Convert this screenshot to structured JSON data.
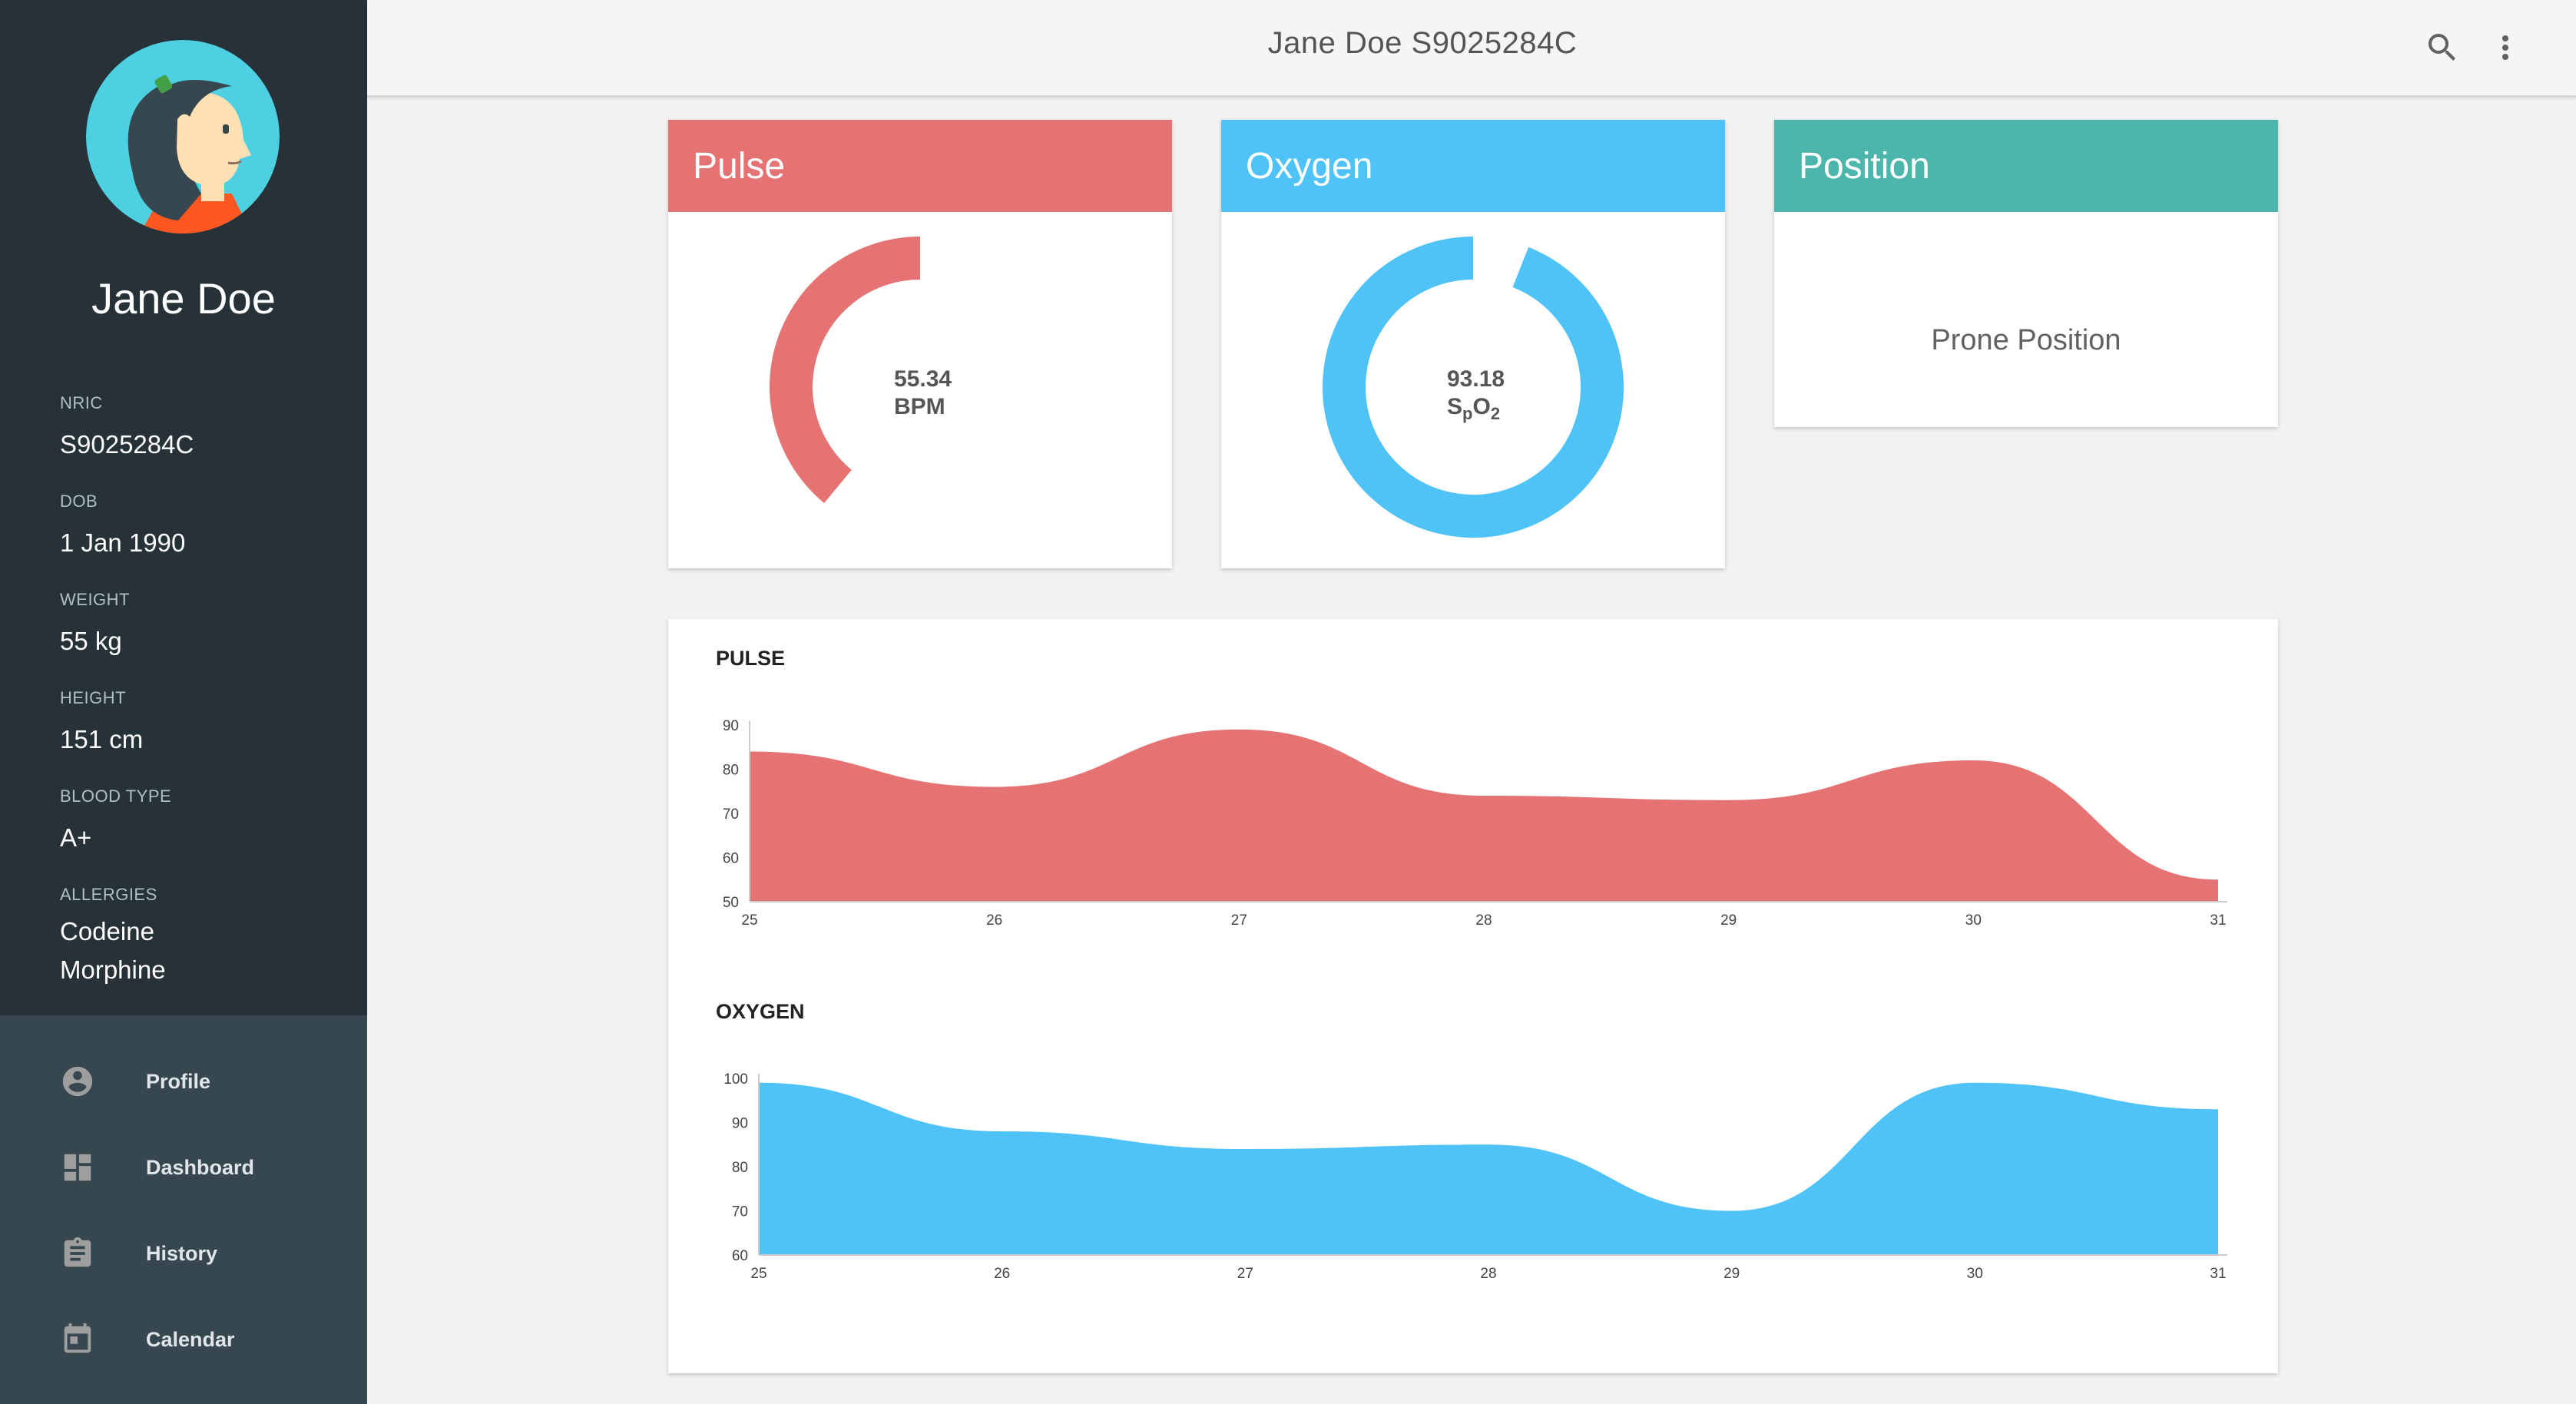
{
  "patient": {
    "name": "Jane Doe",
    "fields": [
      {
        "label": "NRIC",
        "value": "S9025284C"
      },
      {
        "label": "DOB",
        "value": "1 Jan 1990"
      },
      {
        "label": "WEIGHT",
        "value": "55 kg"
      },
      {
        "label": "HEIGHT",
        "value": "151 cm"
      },
      {
        "label": "BLOOD TYPE",
        "value": "A+"
      },
      {
        "label": "ALLERGIES",
        "values": [
          "Codeine",
          "Morphine"
        ]
      }
    ]
  },
  "nav": {
    "items": [
      {
        "label": "Profile",
        "icon": "account-circle-icon"
      },
      {
        "label": "Dashboard",
        "icon": "dashboard-icon"
      },
      {
        "label": "History",
        "icon": "clipboard-icon"
      },
      {
        "label": "Calendar",
        "icon": "calendar-icon"
      }
    ]
  },
  "topbar": {
    "title": "Jane Doe S9025284C",
    "actions": [
      "search-icon",
      "more-vert-icon"
    ]
  },
  "cards": {
    "pulse": {
      "title": "Pulse",
      "value": "55.34",
      "unit": "BPM",
      "level": 0.5,
      "color": "#e57373"
    },
    "oxygen": {
      "title": "Oxygen",
      "value": "93.18",
      "unit_main": "S",
      "unit_sub1": "p",
      "unit_mid": "O",
      "unit_sub2": "2",
      "level": 0.94,
      "color": "#4fc3f7"
    },
    "position": {
      "title": "Position",
      "value": "Prone Position",
      "color": "#4db6ac"
    }
  },
  "colors": {
    "sidebar": "#263238",
    "nav": "#37474f",
    "pulse": "#e57373",
    "oxygen": "#4fc3f7",
    "position": "#4db6ac"
  },
  "chart_data": [
    {
      "type": "area",
      "title": "PULSE",
      "x": [
        25,
        26,
        27,
        28,
        29,
        30,
        31
      ],
      "values": [
        84,
        76,
        89,
        74,
        73,
        82,
        55
      ],
      "y_ticks": [
        50,
        60,
        70,
        80,
        90
      ],
      "ylim": [
        50,
        90
      ],
      "color": "#e57373"
    },
    {
      "type": "area",
      "title": "OXYGEN",
      "x": [
        25,
        26,
        27,
        28,
        29,
        30,
        31
      ],
      "values": [
        99,
        88,
        84,
        85,
        70,
        99,
        93
      ],
      "y_ticks": [
        60,
        70,
        80,
        90,
        100
      ],
      "ylim": [
        60,
        100
      ],
      "color": "#4fc3f7"
    }
  ]
}
